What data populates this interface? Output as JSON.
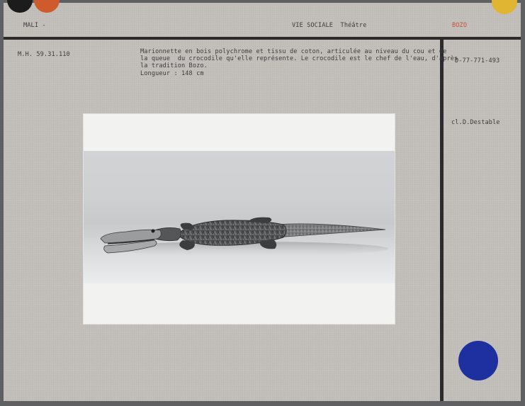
{
  "header": {
    "country": "MALI -",
    "category": "VIE SOCIALE  Théâtre",
    "people": "BOZO"
  },
  "record": {
    "inventory_number": "M.H. 59.31.110",
    "description_line1": "Marionnette en bois polychrome et tissu de coton, articulée au niveau du cou et de",
    "description_line2": "la queue  du crocodile qu'elle représente. Le crocodile est le chef de l'eau, d'après",
    "description_line3": "la tradition Bozo.",
    "length": "Longueur : 148 cm"
  },
  "side": {
    "negative_number": "D-77-771-493",
    "photo_credit": "cl.D.Destable"
  },
  "colors": {
    "card": "#c2bfba",
    "rule": "#2b2b2b",
    "punch_black": "#1c1c1c",
    "punch_orange": "#cf5a2c",
    "punch_yellow": "#e0b531",
    "dot_blue": "#1e2fa0",
    "people_text": "#c8503a"
  }
}
